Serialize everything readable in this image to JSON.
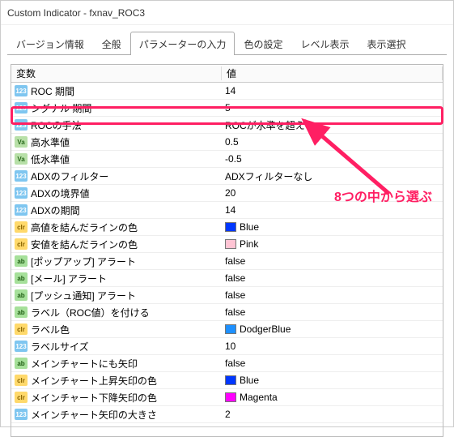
{
  "window": {
    "title": "Custom Indicator - fxnav_ROC3"
  },
  "tabs": {
    "items": [
      {
        "label": "バージョン情報"
      },
      {
        "label": "全般"
      },
      {
        "label": "パラメーターの入力"
      },
      {
        "label": "色の設定"
      },
      {
        "label": "レベル表示"
      },
      {
        "label": "表示選択"
      }
    ],
    "active_index": 2
  },
  "grid": {
    "header_var": "変数",
    "header_val": "値"
  },
  "rows": [
    {
      "icon": "int",
      "name": "ROC 期間",
      "val": "14"
    },
    {
      "icon": "int",
      "name": "シグナル 期間",
      "val": "5"
    },
    {
      "icon": "int",
      "name": "ROCの手法",
      "val": "ROCが水準を超える"
    },
    {
      "icon": "dbl",
      "name": "高水準値",
      "val": "0.5"
    },
    {
      "icon": "dbl",
      "name": "低水準値",
      "val": "-0.5"
    },
    {
      "icon": "int",
      "name": "ADXのフィルター",
      "val": "ADXフィルターなし"
    },
    {
      "icon": "int",
      "name": "ADXの境界値",
      "val": "20"
    },
    {
      "icon": "int",
      "name": "ADXの期間",
      "val": "14"
    },
    {
      "icon": "color",
      "name": "高値を結んだラインの色",
      "val": "Blue",
      "swatch": "#0037ff"
    },
    {
      "icon": "color",
      "name": "安値を結んだラインの色",
      "val": "Pink",
      "swatch": "#ffc4d4"
    },
    {
      "icon": "bool",
      "name": "[ポップアップ] アラート",
      "val": "false"
    },
    {
      "icon": "bool",
      "name": "[メール] アラート",
      "val": "false"
    },
    {
      "icon": "bool",
      "name": "[プッシュ通知] アラート",
      "val": "false"
    },
    {
      "icon": "bool",
      "name": "ラベル（ROC値）を付ける",
      "val": "false"
    },
    {
      "icon": "color",
      "name": "ラベル色",
      "val": "DodgerBlue",
      "swatch": "#1e90ff"
    },
    {
      "icon": "int",
      "name": "ラベルサイズ",
      "val": "10"
    },
    {
      "icon": "bool",
      "name": "メインチャートにも矢印",
      "val": "false"
    },
    {
      "icon": "color",
      "name": "メインチャート上昇矢印の色",
      "val": "Blue",
      "swatch": "#0037ff"
    },
    {
      "icon": "color",
      "name": "メインチャート下降矢印の色",
      "val": "Magenta",
      "swatch": "#ff00ff"
    },
    {
      "icon": "int",
      "name": "メインチャート矢印の大きさ",
      "val": "2"
    }
  ],
  "annotation": {
    "text": "8つの中から選ぶ"
  },
  "icon_glyph": {
    "int": "123",
    "dbl": "Va",
    "color": "clr",
    "bool": "ab",
    "str": "ab"
  }
}
